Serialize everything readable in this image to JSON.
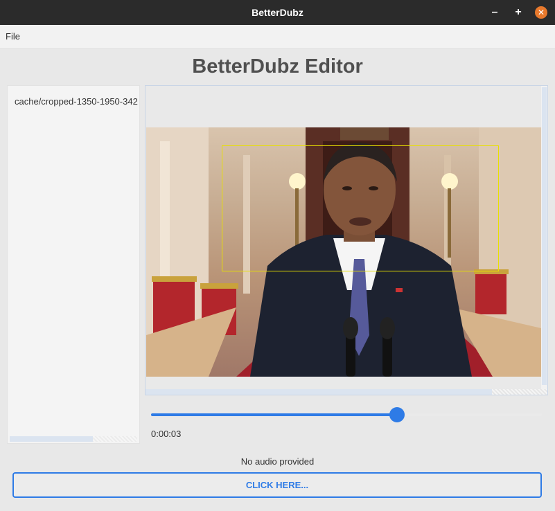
{
  "window": {
    "title": "BetterDubz",
    "minimize_label": "–",
    "maximize_label": "+",
    "close_label": "✕"
  },
  "menu": {
    "file": "File"
  },
  "app": {
    "heading": "BetterDubz Editor"
  },
  "sidebar": {
    "items": [
      {
        "label": "cache/cropped-1350-1950-342"
      }
    ]
  },
  "player": {
    "progress_fraction": 0.63,
    "time": "0:00:03"
  },
  "audio": {
    "status": "No audio provided",
    "button_label": "CLICK HERE..."
  },
  "colors": {
    "accent": "#2e7be6",
    "close_button": "#e8792c",
    "titlebar": "#2b2b2b",
    "roi_box": "#e8e000"
  }
}
